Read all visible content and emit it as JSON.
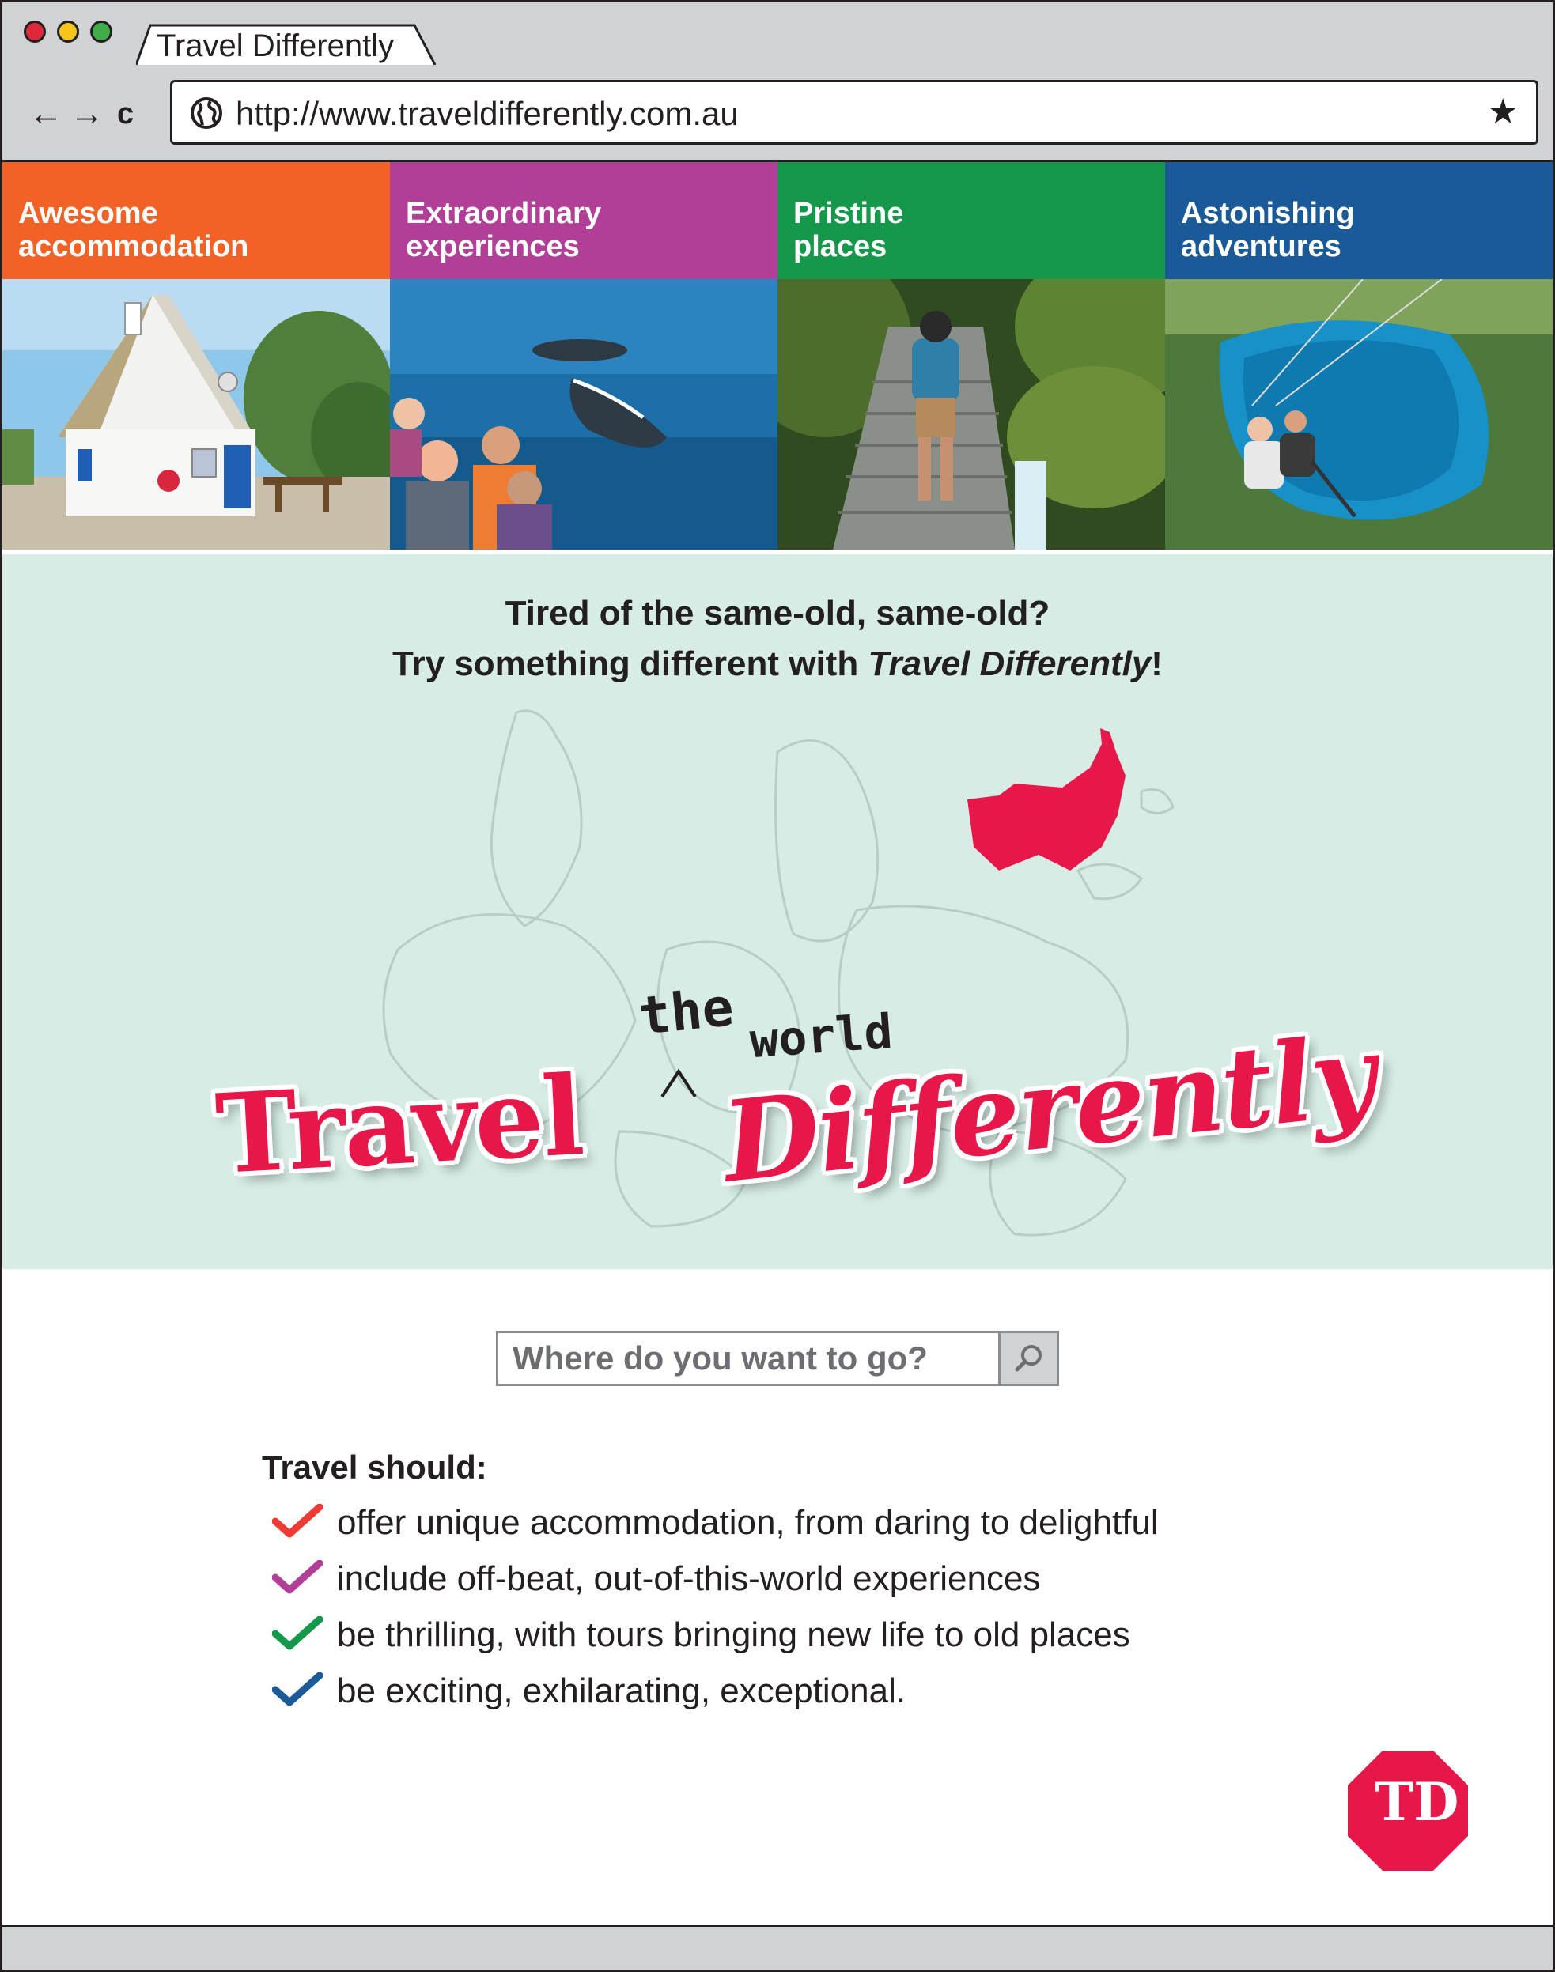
{
  "browser": {
    "tab_title": "Travel Differently",
    "url": "http://www.traveldifferently.com.au",
    "nav": {
      "back": "←",
      "forward": "→",
      "reload": "c"
    }
  },
  "tiles": [
    {
      "line1": "Awesome",
      "line2": "accommodation",
      "color": "#f26125",
      "icon": "cottage-photo"
    },
    {
      "line1": "Extraordinary",
      "line2": "experiences",
      "color": "#b23f97",
      "icon": "whale-watching-photo"
    },
    {
      "line1": "Pristine",
      "line2": "places",
      "color": "#16984b",
      "icon": "rainforest-hiker-photo"
    },
    {
      "line1": "Astonishing",
      "line2": "adventures",
      "color": "#1a5a98",
      "icon": "paragliding-photo"
    }
  ],
  "hero": {
    "line1": "Tired of the same-old, same-old?",
    "line2_prefix": "Try something different with ",
    "line2_brand": "Travel Differently",
    "line2_suffix": "!",
    "logo": {
      "word1": "Travel",
      "insert1": "the",
      "insert2": "world",
      "word2": "Differently"
    },
    "background": "#d6ece4",
    "accent": "#e8174a"
  },
  "search": {
    "placeholder": "Where do you want to go?"
  },
  "benefits": {
    "title": "Travel should:",
    "items": [
      {
        "text": "offer unique accommodation, from daring to delightful",
        "check_color": "#ee3b33"
      },
      {
        "text": "include off-beat, out-of-this-world experiences",
        "check_color": "#b23f97"
      },
      {
        "text": "be thrilling, with tours bringing new life to old places",
        "check_color": "#16984b"
      },
      {
        "text": "be exciting, exhilarating, exceptional.",
        "check_color": "#1a5a98"
      }
    ]
  },
  "badge": {
    "text": "TD"
  }
}
